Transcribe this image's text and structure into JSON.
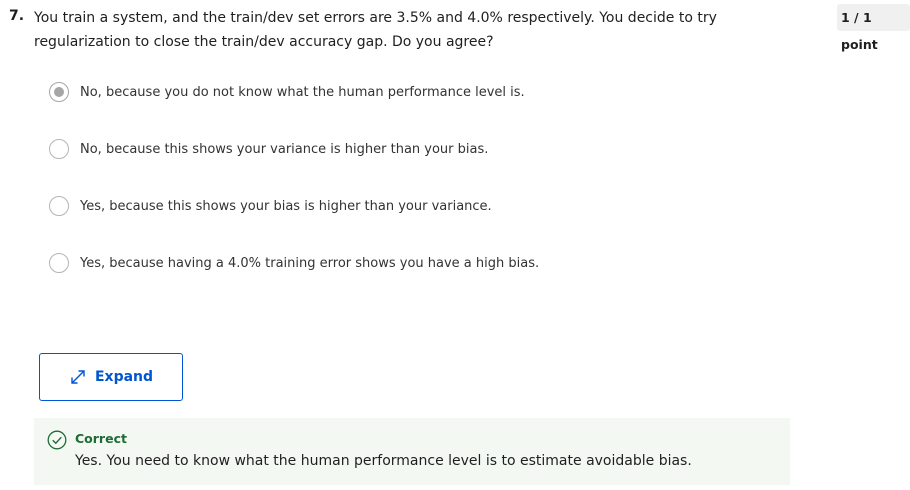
{
  "question": {
    "number": "7.",
    "text": "You train a system, and the train/dev set errors are 3.5% and 4.0% respectively. You decide to try regularization to close the train/dev accuracy gap. Do you agree?",
    "points": "1 / 1 point"
  },
  "options": [
    {
      "label": "No, because you do not know what the human performance level is.",
      "selected": true
    },
    {
      "label": "No, because this shows your variance is higher than your bias.",
      "selected": false
    },
    {
      "label": "Yes, because this shows your bias is higher than your variance.",
      "selected": false
    },
    {
      "label": "Yes, because having a 4.0% training error shows you have a high bias.",
      "selected": false
    }
  ],
  "expand": {
    "label": "Expand",
    "icon": "expand-arrows-icon"
  },
  "feedback": {
    "status": "Correct",
    "icon": "check-circle-icon",
    "text": "Yes. You need to know what the human performance level is to estimate avoidable bias."
  },
  "colors": {
    "accent": "#0056d2",
    "correct_green": "#1e6b34",
    "feedback_bg": "#f3f8f3",
    "radio_selected": "#a6a6a6"
  }
}
